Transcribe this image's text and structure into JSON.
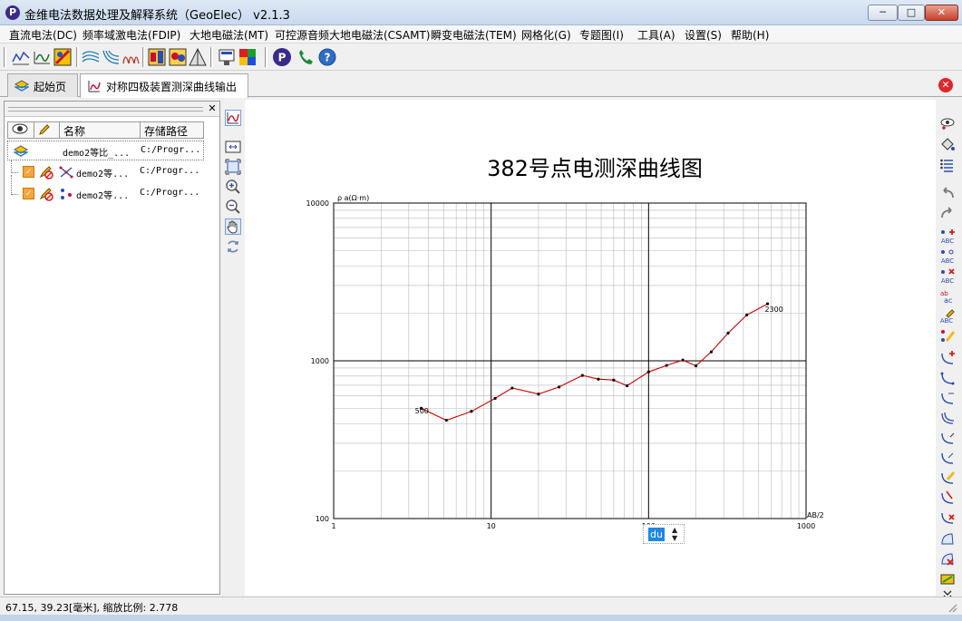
{
  "window": {
    "title": "金维电法数据处理及解释系统（GeoElec） v2.1.3",
    "app_icon_letter": "P"
  },
  "menu": [
    "直流电法(DC)",
    "频率域激电法(FDIP)",
    "大地电磁法(MT)",
    "可控源音频大地电磁法(CSAMT)",
    "瞬变电磁法(TEM)",
    "网格化(G)",
    "专题图(I)",
    "工具(A)",
    "设置(S)",
    "帮助(H)"
  ],
  "tabs": [
    {
      "label": "起始页",
      "icon": "layers-icon"
    },
    {
      "label": "对称四极装置测深曲线输出",
      "icon": "curve-chart-icon"
    }
  ],
  "layer_panel": {
    "columns": [
      "名称",
      "存储路径"
    ],
    "rows": [
      {
        "name": "demo2等比_...",
        "path": "C:/Progr..."
      },
      {
        "name": "demo2等...",
        "path": "C:/Progr..."
      },
      {
        "name": "demo2等...",
        "path": "C:/Progr..."
      }
    ]
  },
  "du_widget": {
    "label": "du"
  },
  "status": {
    "text": "67.15, 39.23[毫米], 缩放比例: 2.778"
  },
  "colors": {
    "curve": "#cc0000",
    "axis": "#000000",
    "grid": "#b8b8b8",
    "du_bg": "#1e88e5"
  },
  "chart_data": {
    "type": "line",
    "title": "382号点电测深曲线图",
    "ylabel": "ρ a(Ω·m)",
    "xlabel": "AB/2",
    "x_scale": "log",
    "y_scale": "log",
    "xlim": [
      1,
      1000
    ],
    "ylim": [
      100,
      10000
    ],
    "x_ticks": [
      "1",
      "10",
      "100",
      "1000"
    ],
    "y_ticks": [
      "100",
      "1000",
      "10000"
    ],
    "grid": true,
    "point_labels": [
      {
        "x": 3.6,
        "y": 488,
        "text": "500"
      },
      {
        "x": 600,
        "y": 2150,
        "text": "2300"
      }
    ],
    "series": [
      {
        "x": [
          3.6,
          5.2,
          7.5,
          10.6,
          13.6,
          20,
          27,
          38,
          48,
          60,
          73,
          100,
          130,
          165,
          200,
          250,
          320,
          420,
          570
        ],
        "y": [
          500,
          420,
          478,
          578,
          672,
          615,
          682,
          808,
          765,
          755,
          695,
          850,
          935,
          1010,
          930,
          1140,
          1500,
          1950,
          2300
        ]
      }
    ]
  }
}
